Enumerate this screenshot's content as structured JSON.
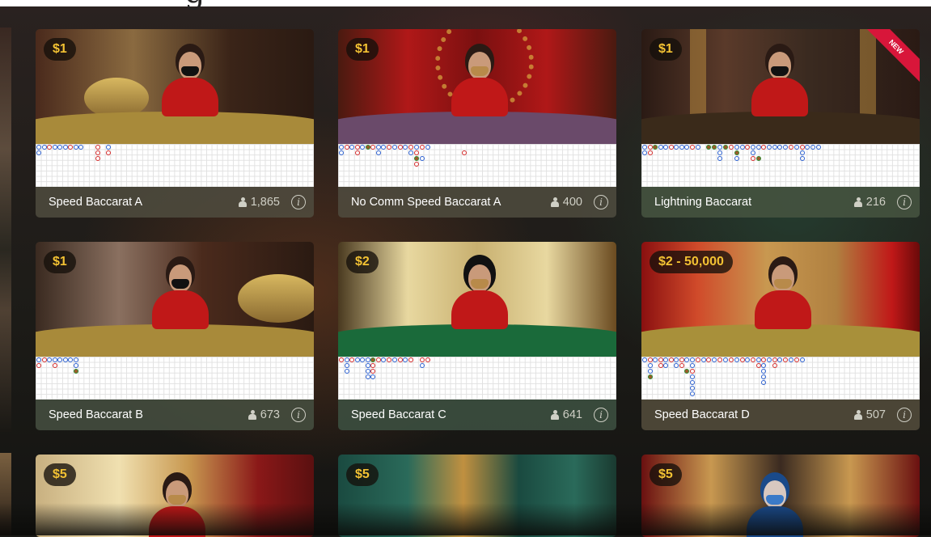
{
  "top_glyph": "g",
  "rows": [
    [
      {
        "name": "Speed Baccarat A",
        "limit": "$1",
        "players": "1,865",
        "new_badge": false
      },
      {
        "name": "No Comm Speed Baccarat A",
        "limit": "$1",
        "players": "400",
        "new_badge": false
      },
      {
        "name": "Lightning Baccarat",
        "limit": "$1",
        "players": "216",
        "new_badge": true,
        "new_label": "NEW"
      }
    ],
    [
      {
        "name": "Speed Baccarat B",
        "limit": "$1",
        "players": "673",
        "new_badge": false
      },
      {
        "name": "Speed Baccarat C",
        "limit": "$2",
        "players": "641",
        "new_badge": false
      },
      {
        "name": "Speed Baccarat D",
        "limit": "$2 - 50,000",
        "players": "507",
        "new_badge": false
      }
    ],
    [
      {
        "limit": "$5"
      },
      {
        "limit": "$5"
      },
      {
        "limit": "$5"
      }
    ]
  ],
  "icons": {
    "players": "person-icon",
    "info": "info-icon",
    "info_glyph": "i"
  },
  "colors": {
    "limit_text": "#f3c233",
    "player_dot": "#2a5fd0",
    "banker_dot": "#d42a2a",
    "new_ribbon": "#d8163a"
  }
}
